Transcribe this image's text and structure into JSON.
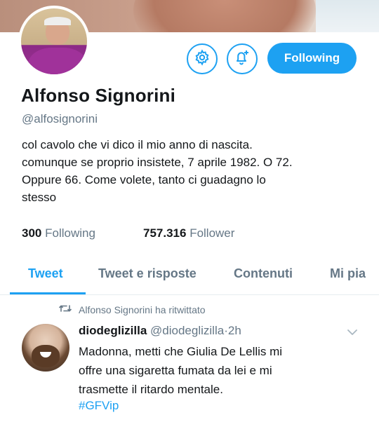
{
  "profile": {
    "name": "Alfonso Signorini",
    "handle": "@alfosignorini",
    "bio_lines": [
      "col cavolo che vi dico il mio anno di nascita.",
      "comunque se proprio insistete, 7 aprile 1982. O 72.",
      "Oppure 66. Come volete, tanto ci guadagno lo",
      "stesso"
    ],
    "following_count": "300",
    "following_label": "Following",
    "follower_count": "757.316",
    "follower_label": "Follower"
  },
  "actions": {
    "settings_icon": "gear-icon",
    "notify_icon": "bell-plus-icon",
    "follow_button_label": "Following"
  },
  "tabs": [
    {
      "label": "Tweet",
      "active": true
    },
    {
      "label": "Tweet e risposte",
      "active": false
    },
    {
      "label": "Contenuti",
      "active": false
    },
    {
      "label": "Mi pia",
      "active": false
    }
  ],
  "tweet": {
    "retweet_note": "Alfonso Signorini ha ritwittato",
    "author_name": "diodeglizilla",
    "author_handle": "@diodeglizilla",
    "separator": "·",
    "time": "2h",
    "text_lines": [
      "Madonna, metti che Giulia De Lellis mi",
      "offre una sigaretta fumata da lei e mi",
      "trasmette il ritardo mentale."
    ],
    "hashtag": "#GFVip"
  },
  "colors": {
    "accent": "#1da1f2",
    "secondary_text": "#657786",
    "primary_text": "#14171a"
  }
}
